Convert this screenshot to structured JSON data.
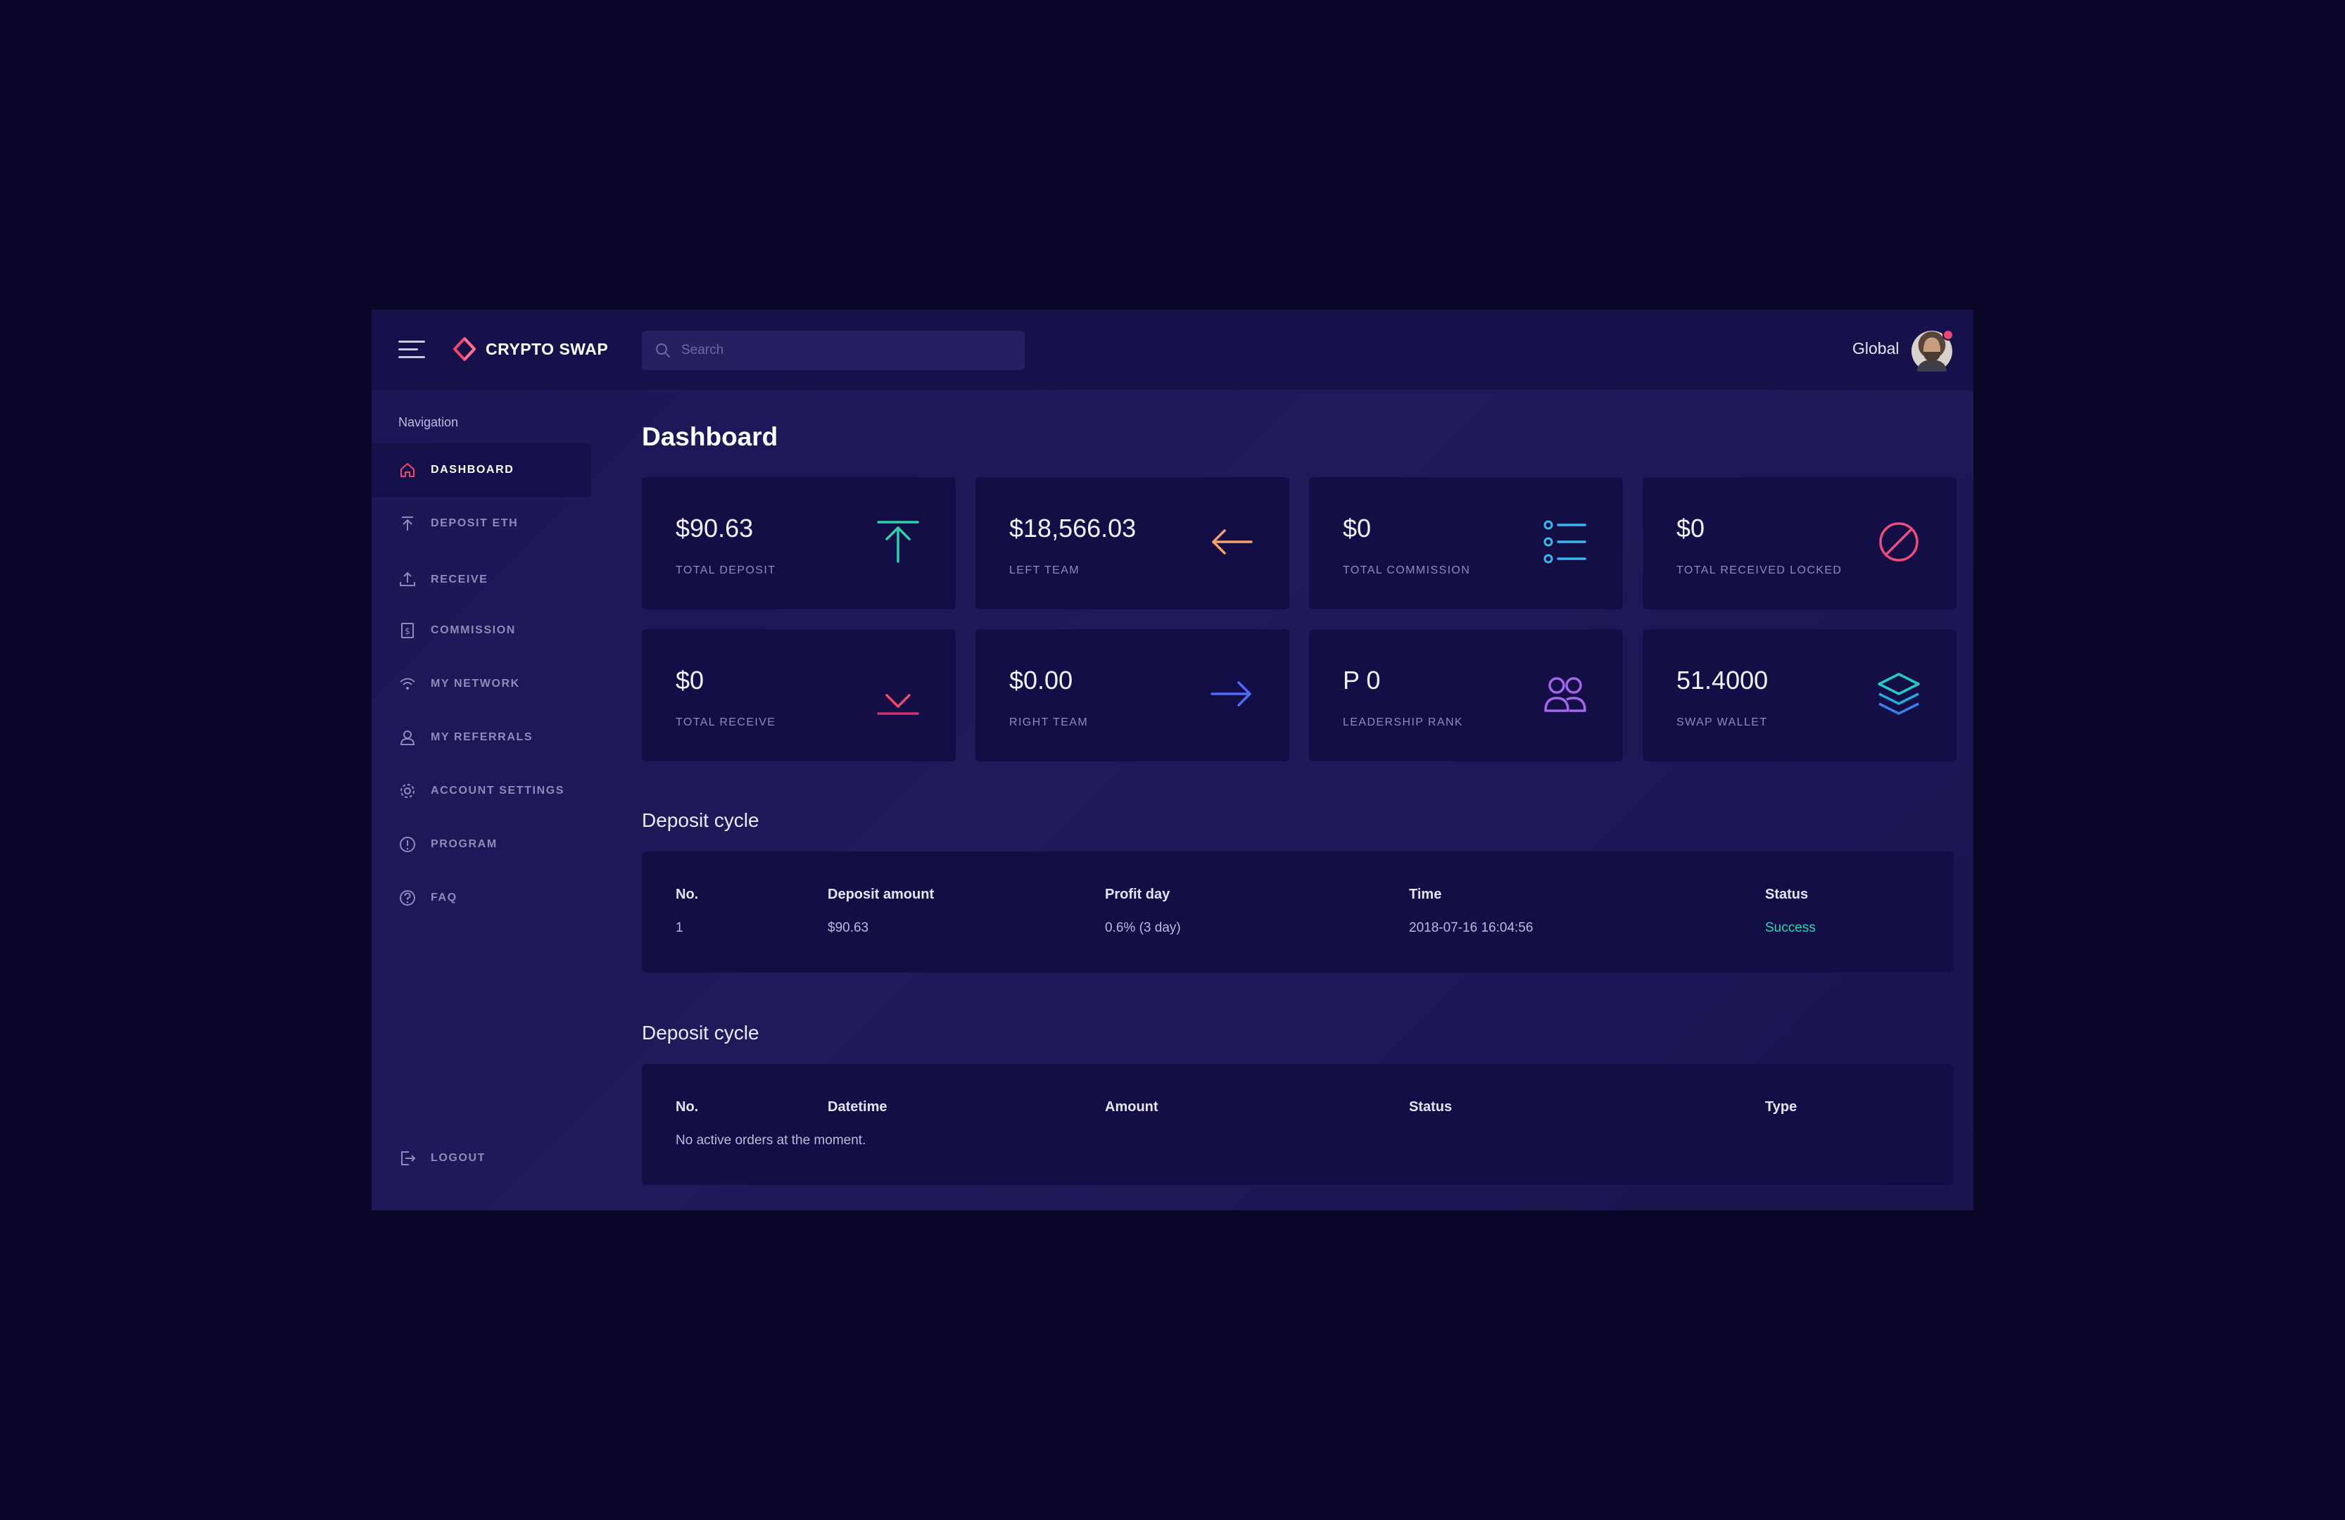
{
  "header": {
    "brand": "CRYPTO SWAP",
    "search_placeholder": "Search",
    "region": "Global"
  },
  "sidebar": {
    "heading": "Navigation",
    "items": [
      {
        "label": "DASHBOARD",
        "icon": "home-icon",
        "active": true
      },
      {
        "label": "DEPOSIT ETH",
        "icon": "upload-arrow-icon"
      },
      {
        "label": "RECEIVE",
        "icon": "upload-tray-icon"
      },
      {
        "label": "COMMISSION",
        "icon": "dollar-document-icon"
      },
      {
        "label": "MY NETWORK",
        "icon": "wifi-icon"
      },
      {
        "label": "MY REFERRALS",
        "icon": "user-icon"
      },
      {
        "label": "ACCOUNT SETTINGS",
        "icon": "gear-icon"
      },
      {
        "label": "PROGRAM",
        "icon": "info-icon"
      },
      {
        "label": "FAQ",
        "icon": "help-icon"
      }
    ],
    "logout": "LOGOUT"
  },
  "page": {
    "title": "Dashboard"
  },
  "cards": [
    {
      "value": "$90.63",
      "label": "TOTAL DEPOSIT",
      "icon": "arrow-up-bar-icon",
      "color": "#2fd0a8"
    },
    {
      "value": "$18,566.03",
      "label": "LEFT TEAM",
      "icon": "arrow-left-icon",
      "color": "#f5a16b"
    },
    {
      "value": "$0",
      "label": "TOTAL COMMISSION",
      "icon": "list-icon",
      "color": "#3cb8ec"
    },
    {
      "value": "$0",
      "label": "TOTAL RECEIVED LOCKED",
      "icon": "blocked-icon",
      "color": "#ef4c7c"
    },
    {
      "value": "$0",
      "label": "TOTAL RECEIVE",
      "icon": "arrow-down-bar-icon",
      "color": "#ee4a6a"
    },
    {
      "value": "$0.00",
      "label": "RIGHT TEAM",
      "icon": "arrow-right-icon",
      "color": "#4f6bf5"
    },
    {
      "value": "P 0",
      "label": "LEADERSHIP RANK",
      "icon": "users-icon",
      "color": "#a466e8"
    },
    {
      "value": "51.4000",
      "label": "SWAP WALLET",
      "icon": "layers-icon",
      "color": "#27c8c8"
    }
  ],
  "deposit_table": {
    "title": "Deposit cycle",
    "headers": [
      "No.",
      "Deposit amount",
      "Profit day",
      "Time",
      "Status"
    ],
    "rows": [
      [
        "1",
        "$90.63",
        "0.6% (3 day)",
        "2018-07-16 16:04:56",
        "Success"
      ]
    ],
    "success_color": "#35d3b2"
  },
  "orders_table": {
    "title": "Deposit cycle",
    "headers": [
      "No.",
      "Datetime",
      "Amount",
      "Status",
      "Type"
    ],
    "empty_text": "No active orders at the moment."
  }
}
